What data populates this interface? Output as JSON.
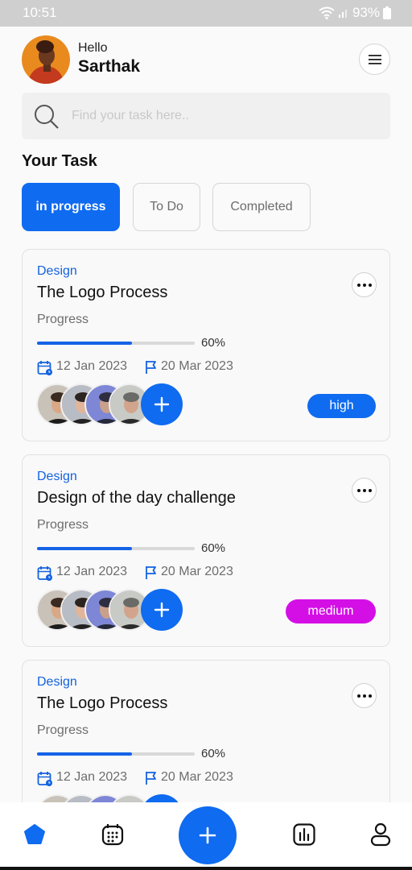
{
  "status_bar": {
    "time": "10:51",
    "battery": "93%"
  },
  "header": {
    "greeting": "Hello",
    "username": "Sarthak"
  },
  "search": {
    "placeholder": "Find your task here.."
  },
  "section_title": "Your Task",
  "tabs": [
    {
      "label": "in progress",
      "active": true
    },
    {
      "label": "To Do",
      "active": false
    },
    {
      "label": "Completed",
      "active": false
    }
  ],
  "tasks": [
    {
      "category": "Design",
      "title": "The Logo Process",
      "progress_label": "Progress",
      "progress_value": 0.6,
      "progress_text": "60%",
      "start_date": "12 Jan 2023",
      "due_date": "20 Mar 2023",
      "priority": "high",
      "priority_color": "#0f6bf0"
    },
    {
      "category": "Design",
      "title": "Design of the day challenge",
      "progress_label": "Progress",
      "progress_value": 0.6,
      "progress_text": "60%",
      "start_date": "12 Jan 2023",
      "due_date": "20 Mar 2023",
      "priority": "medium",
      "priority_color": "#d40fe6"
    },
    {
      "category": "Design",
      "title": "The Logo Process",
      "progress_label": "Progress",
      "progress_value": 0.6,
      "progress_text": "60%",
      "start_date": "12 Jan 2023",
      "due_date": "20 Mar 2023"
    }
  ],
  "bottom_nav": {
    "items": [
      {
        "icon": "home-icon",
        "active": true
      },
      {
        "icon": "calendar-icon",
        "active": false
      },
      {
        "icon": "add-icon",
        "active": false
      },
      {
        "icon": "stats-icon",
        "active": false
      },
      {
        "icon": "profile-icon",
        "active": false
      }
    ]
  },
  "colors": {
    "accent": "#0f6bf0",
    "high": "#0f6bf0",
    "medium": "#d40fe6",
    "background": "#fafafa"
  }
}
